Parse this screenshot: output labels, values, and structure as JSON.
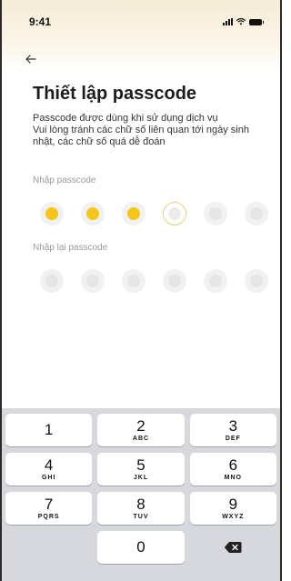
{
  "status_bar": {
    "time": "9:41"
  },
  "header": {
    "title": "Thiết lập passcode",
    "description_lines": [
      "Passcode được dùng khi sử dụng dịch vụ",
      "Vui lòng tránh các chữ số liên quan tới ngày sinh",
      "nhật, các chữ số quá dễ đoán"
    ]
  },
  "passcode": {
    "label": "Nhập passcode",
    "length": 6,
    "entered_count": 3
  },
  "confirm": {
    "label": "Nhập lại passcode",
    "length": 6,
    "entered_count": 0
  },
  "keypad": {
    "rows": [
      [
        {
          "digit": "1",
          "letters": ""
        },
        {
          "digit": "2",
          "letters": "ABC"
        },
        {
          "digit": "3",
          "letters": "DEF"
        }
      ],
      [
        {
          "digit": "4",
          "letters": "GHI"
        },
        {
          "digit": "5",
          "letters": "JKL"
        },
        {
          "digit": "6",
          "letters": "MNO"
        }
      ],
      [
        {
          "digit": "7",
          "letters": "PQRS"
        },
        {
          "digit": "8",
          "letters": "TUV"
        },
        {
          "digit": "9",
          "letters": "WXYZ"
        }
      ]
    ],
    "zero": "0"
  },
  "colors": {
    "filled_dot": "#f5c518",
    "active_dot_ring": "#e8cf7e",
    "keypad_bg": "#d6d8dd"
  }
}
